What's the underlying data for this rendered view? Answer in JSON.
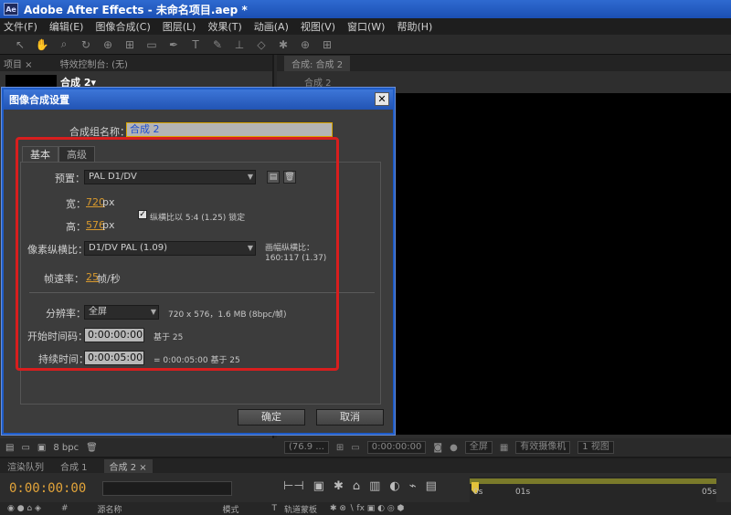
{
  "app": {
    "title": "Adobe After Effects - 未命名项目.aep *",
    "logo_text": "Ae"
  },
  "menu": [
    "文件(F)",
    "编辑(E)",
    "图像合成(C)",
    "图层(L)",
    "效果(T)",
    "动画(A)",
    "视图(V)",
    "窗口(W)",
    "帮助(H)"
  ],
  "left_panel": {
    "tabs": [
      "项目 ×",
      "特效控制台: (无)"
    ],
    "comp_name": "合成 2▾",
    "bpc": "8 bpc"
  },
  "right_panel": {
    "tab": "合成: 合成 2",
    "sub": "合成 2",
    "zoom": "(76.9 ...",
    "timecode": "0:00:00:00",
    "resolution": "全屏",
    "camera": "有效摄像机",
    "views": "1 视图"
  },
  "timeline": {
    "tabs": [
      "渲染队列",
      "合成 1",
      "合成 2 ×"
    ],
    "timecode": "0:00:00:00",
    "ruler_ticks": [
      "0s",
      "01s",
      "05s"
    ],
    "columns": [
      "源名称",
      "模式",
      "T",
      "轨道蒙板"
    ]
  },
  "dialog": {
    "title": "图像合成设置",
    "name_label": "合成组名称：",
    "name_value": "合成 2",
    "tabs": [
      "基本",
      "高级"
    ],
    "preset_label": "预置：",
    "preset_value": "PAL D1/DV",
    "width_label": "宽：",
    "width_value": "720",
    "height_label": "高：",
    "height_value": "576",
    "unit_px": "px",
    "lock_ratio": "纵横比以 5:4 (1.25) 锁定",
    "pixel_aspect_label": "像素纵横比：",
    "pixel_aspect_value": "D1/DV PAL (1.09)",
    "frame_aspect_label": "画幅纵横比：",
    "frame_aspect_value": "160:117 (1.37)",
    "fps_label": "帧速率：",
    "fps_value": "25",
    "fps_unit": "帧/秒",
    "resolution_label": "分辨率：",
    "resolution_value": "全屏",
    "resolution_info": "720 x 576，1.6 MB (8bpc/帧)",
    "start_tc_label": "开始时间码：",
    "start_tc_value": "0:00:00:00",
    "start_tc_base": "基于 25",
    "duration_label": "持续时间：",
    "duration_value": "0:00:05:00",
    "duration_info": "= 0:00:05:00  基于 25",
    "ok": "确定",
    "cancel": "取消"
  },
  "colors": {
    "accent_red": "#d81e1e",
    "orange_value": "#d99a2e",
    "title_blue": "#2254b4"
  }
}
